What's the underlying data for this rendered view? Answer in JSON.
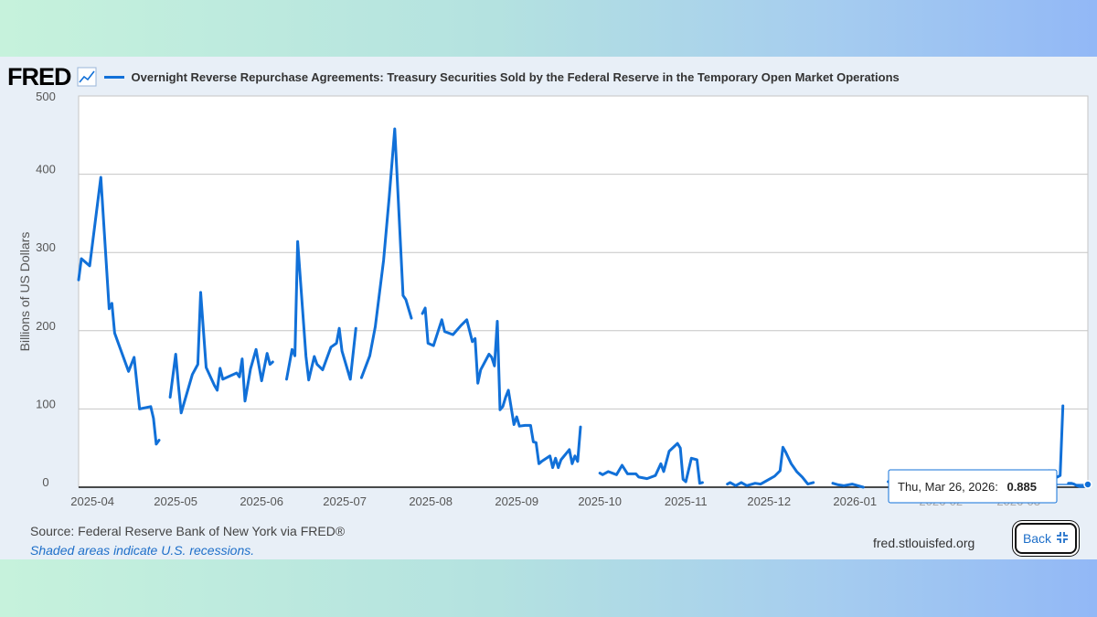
{
  "header": {
    "logo_text": "FRED",
    "title": "Overnight Reverse Repurchase Agreements: Treasury Securities Sold by the Federal Reserve in the Temporary Open Market Operations"
  },
  "footer": {
    "source": "Source: Federal Reserve Bank of New York via FRED®",
    "recession_note": "Shaded areas indicate U.S. recessions.",
    "url": "fred.stlouisfed.org",
    "back_label": "Back"
  },
  "tooltip": {
    "date_label": "Thu, Mar 26, 2026:",
    "value_label": "0.885"
  },
  "colors": {
    "series": "#1170d8",
    "plot_bg": "#ffffff",
    "grid": "#c6c6c6"
  },
  "chart_data": {
    "type": "line",
    "ylabel": "Billions of US Dollars",
    "xlabel": "",
    "ylim": [
      0,
      500
    ],
    "yticks": [
      0,
      100,
      200,
      300,
      400,
      500
    ],
    "xlim": [
      "2025-03-27",
      "2026-03-26"
    ],
    "xticks": [
      "2025-04",
      "2025-05",
      "2025-06",
      "2025-07",
      "2025-08",
      "2025-09",
      "2025-10",
      "2025-11",
      "2025-12",
      "2026-01",
      "2026-02",
      "2026-03"
    ],
    "grid": true,
    "series": [
      {
        "segments": [
          [
            [
              "2025-03-27",
              265
            ],
            [
              "2025-03-28",
              292
            ],
            [
              "2025-03-31",
              283
            ],
            [
              "2025-04-04",
              396
            ],
            [
              "2025-04-07",
              228
            ],
            [
              "2025-04-08",
              235
            ],
            [
              "2025-04-09",
              197
            ],
            [
              "2025-04-14",
              148
            ],
            [
              "2025-04-16",
              166
            ],
            [
              "2025-04-18",
              100
            ],
            [
              "2025-04-22",
              103
            ],
            [
              "2025-04-23",
              88
            ],
            [
              "2025-04-24",
              55
            ],
            [
              "2025-04-25",
              60
            ]
          ],
          [
            [
              "2025-04-29",
              115
            ],
            [
              "2025-05-01",
              170
            ],
            [
              "2025-05-02",
              130
            ],
            [
              "2025-05-03",
              95
            ],
            [
              "2025-05-07",
              144
            ],
            [
              "2025-05-09",
              157
            ],
            [
              "2025-05-10",
              249
            ],
            [
              "2025-05-12",
              153
            ],
            [
              "2025-05-15",
              130
            ],
            [
              "2025-05-16",
              124
            ],
            [
              "2025-05-17",
              152
            ],
            [
              "2025-05-18",
              138
            ],
            [
              "2025-05-23",
              146
            ],
            [
              "2025-05-24",
              141
            ],
            [
              "2025-05-25",
              164
            ],
            [
              "2025-05-26",
              110
            ],
            [
              "2025-05-28",
              151
            ],
            [
              "2025-05-30",
              176
            ],
            [
              "2025-06-01",
              136
            ],
            [
              "2025-06-03",
              171
            ],
            [
              "2025-06-04",
              157
            ],
            [
              "2025-06-05",
              160
            ]
          ],
          [
            [
              "2025-06-10",
              138
            ],
            [
              "2025-06-12",
              176
            ],
            [
              "2025-06-13",
              168
            ],
            [
              "2025-06-14",
              314
            ],
            [
              "2025-06-17",
              167
            ],
            [
              "2025-06-18",
              137
            ],
            [
              "2025-06-20",
              167
            ],
            [
              "2025-06-21",
              157
            ],
            [
              "2025-06-23",
              150
            ],
            [
              "2025-06-26",
              179
            ],
            [
              "2025-06-28",
              184
            ],
            [
              "2025-06-29",
              203
            ],
            [
              "2025-06-30",
              174
            ],
            [
              "2025-07-03",
              138
            ],
            [
              "2025-07-05",
              203
            ]
          ],
          [
            [
              "2025-07-07",
              140
            ],
            [
              "2025-07-10",
              168
            ],
            [
              "2025-07-12",
              205
            ],
            [
              "2025-07-15",
              290
            ],
            [
              "2025-07-17",
              370
            ],
            [
              "2025-07-19",
              458
            ],
            [
              "2025-07-22",
              245
            ],
            [
              "2025-07-23",
              240
            ],
            [
              "2025-07-25",
              216
            ]
          ],
          [
            [
              "2025-07-29",
              222
            ],
            [
              "2025-07-30",
              229
            ],
            [
              "2025-07-31",
              184
            ],
            [
              "2025-08-02",
              181
            ],
            [
              "2025-08-05",
              214
            ],
            [
              "2025-08-06",
              199
            ],
            [
              "2025-08-09",
              195
            ],
            [
              "2025-08-12",
              207
            ],
            [
              "2025-08-14",
              214
            ],
            [
              "2025-08-16",
              186
            ],
            [
              "2025-08-17",
              190
            ],
            [
              "2025-08-18",
              133
            ],
            [
              "2025-08-19",
              150
            ],
            [
              "2025-08-22",
              170
            ],
            [
              "2025-08-23",
              166
            ],
            [
              "2025-08-24",
              155
            ],
            [
              "2025-08-25",
              212
            ],
            [
              "2025-08-26",
              99
            ],
            [
              "2025-08-27",
              103
            ],
            [
              "2025-08-28",
              115
            ],
            [
              "2025-08-29",
              124
            ],
            [
              "2025-08-31",
              80
            ],
            [
              "2025-09-01",
              90
            ],
            [
              "2025-09-02",
              78
            ],
            [
              "2025-09-04",
              79
            ],
            [
              "2025-09-06",
              79
            ],
            [
              "2025-09-07",
              58
            ],
            [
              "2025-09-08",
              57
            ],
            [
              "2025-09-09",
              30
            ],
            [
              "2025-09-10",
              33
            ],
            [
              "2025-09-13",
              40
            ],
            [
              "2025-09-14",
              25
            ],
            [
              "2025-09-15",
              37
            ],
            [
              "2025-09-16",
              25
            ],
            [
              "2025-09-17",
              35
            ],
            [
              "2025-09-20",
              48
            ],
            [
              "2025-09-21",
              30
            ],
            [
              "2025-09-22",
              40
            ],
            [
              "2025-09-23",
              33
            ],
            [
              "2025-09-24",
              77
            ]
          ],
          [
            [
              "2025-10-01",
              18
            ],
            [
              "2025-10-02",
              16
            ],
            [
              "2025-10-04",
              20
            ],
            [
              "2025-10-07",
              16
            ],
            [
              "2025-10-09",
              28
            ],
            [
              "2025-10-11",
              17
            ],
            [
              "2025-10-14",
              17
            ],
            [
              "2025-10-15",
              13
            ],
            [
              "2025-10-18",
              11
            ],
            [
              "2025-10-21",
              15
            ],
            [
              "2025-10-23",
              30
            ],
            [
              "2025-10-24",
              20
            ],
            [
              "2025-10-26",
              46
            ],
            [
              "2025-10-29",
              56
            ],
            [
              "2025-10-30",
              50
            ],
            [
              "2025-10-31",
              10
            ],
            [
              "2025-11-01",
              7
            ],
            [
              "2025-11-03",
              37
            ],
            [
              "2025-11-05",
              35
            ],
            [
              "2025-11-06",
              5
            ],
            [
              "2025-11-07",
              6
            ]
          ],
          [
            [
              "2025-11-16",
              4
            ],
            [
              "2025-11-17",
              6
            ],
            [
              "2025-11-19",
              2
            ],
            [
              "2025-11-21",
              6
            ],
            [
              "2025-11-23",
              2
            ],
            [
              "2025-11-26",
              5
            ],
            [
              "2025-11-28",
              4
            ],
            [
              "2025-12-01",
              10
            ],
            [
              "2025-12-03",
              14
            ],
            [
              "2025-12-05",
              21
            ],
            [
              "2025-12-06",
              51
            ],
            [
              "2025-12-07",
              45
            ],
            [
              "2025-12-09",
              30
            ],
            [
              "2025-12-11",
              20
            ],
            [
              "2025-12-13",
              13
            ],
            [
              "2025-12-15",
              4
            ],
            [
              "2025-12-17",
              6
            ]
          ],
          [
            [
              "2025-12-24",
              5
            ],
            [
              "2025-12-26",
              3
            ],
            [
              "2025-12-28",
              2
            ],
            [
              "2025-12-31",
              4
            ],
            [
              "2026-01-02",
              2
            ],
            [
              "2026-01-04",
              0
            ]
          ],
          [
            [
              "2026-01-13",
              7
            ],
            [
              "2026-01-15",
              3
            ],
            [
              "2026-01-18",
              3
            ],
            [
              "2026-01-20",
              6
            ],
            [
              "2026-01-22",
              1
            ],
            [
              "2026-01-24",
              2
            ],
            [
              "2026-01-26",
              4
            ],
            [
              "2026-01-29",
              3
            ],
            [
              "2026-02-01",
              2
            ],
            [
              "2026-02-03",
              7
            ],
            [
              "2026-02-05",
              2
            ],
            [
              "2026-02-07",
              2
            ],
            [
              "2026-02-09",
              7
            ]
          ],
          [
            [
              "2026-02-14",
              4
            ],
            [
              "2026-02-16",
              2
            ],
            [
              "2026-02-18",
              1
            ],
            [
              "2026-02-21",
              2
            ],
            [
              "2026-02-23",
              6
            ],
            [
              "2026-02-25",
              1
            ],
            [
              "2026-02-28",
              2
            ],
            [
              "2026-03-02",
              12
            ],
            [
              "2026-03-03",
              10
            ],
            [
              "2026-03-05",
              1
            ],
            [
              "2026-03-07",
              6
            ]
          ],
          [
            [
              "2026-03-12",
              21
            ],
            [
              "2026-03-13",
              17
            ],
            [
              "2026-03-15",
              13
            ],
            [
              "2026-03-16",
              15
            ],
            [
              "2026-03-17",
              104
            ]
          ],
          [
            [
              "2026-03-19",
              5
            ],
            [
              "2026-03-20",
              5
            ],
            [
              "2026-03-21",
              4
            ],
            [
              "2026-03-22",
              2
            ],
            [
              "2026-03-23",
              1
            ],
            [
              "2026-03-24",
              1
            ],
            [
              "2026-03-25",
              1
            ],
            [
              "2026-03-26",
              0.885
            ]
          ]
        ]
      }
    ]
  }
}
